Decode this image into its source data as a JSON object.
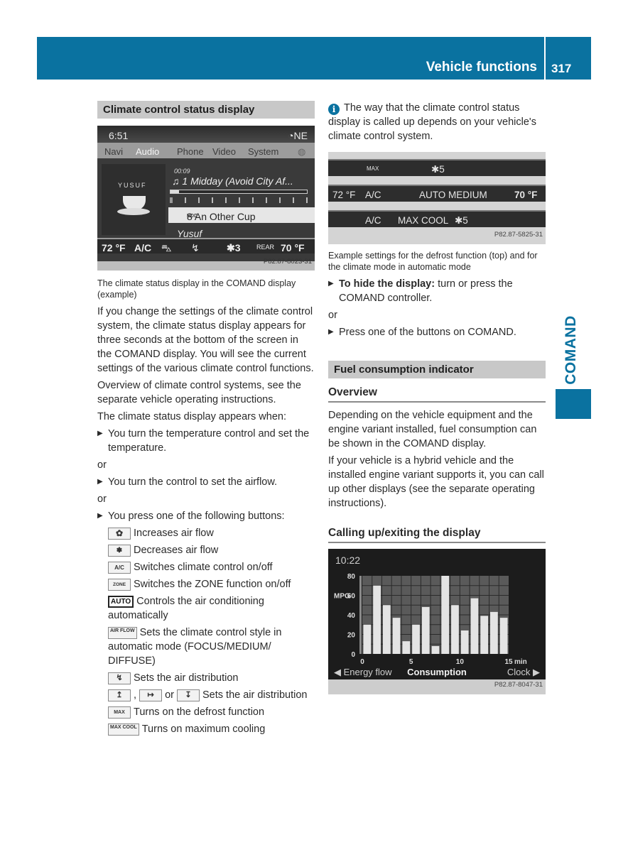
{
  "header": {
    "title": "Vehicle functions",
    "page_number": "317"
  },
  "side_tab": {
    "label": "COMAND"
  },
  "colors": {
    "brand_blue": "#0a72a0",
    "section_bar": "#c8c8c8"
  },
  "left": {
    "section_title": "Climate control status display",
    "screenshot1": {
      "time": "6:51",
      "compass": "◔NE",
      "nav_tabs": [
        "Navi",
        "Audio",
        "Phone",
        "Video",
        "System"
      ],
      "active_tab": "Audio",
      "elapsed": "00:09",
      "album_artist_logo": "YUSUF",
      "track": "♫  1 Midday (Avoid City Af...",
      "progress_fraction": 0.06,
      "selected_track": "8 An Other Cup",
      "source_badge": "HDD",
      "artist": "Yusuf",
      "climate": {
        "left_temp": "72 °F",
        "ac": "A/C",
        "fan": "✱3",
        "rear": "REAR",
        "right_temp": "70 °F"
      },
      "image_code": "P82.87-8023-31"
    },
    "caption": "The climate status display in the COMAND display (example)",
    "para1": "If you change the settings of the climate control system, the climate status display appears for three seconds at the bottom of the screen in the COMAND display. You will see the current settings of the various climate control functions.",
    "para2": "Overview of climate control systems, see the separate vehicle operating instructions.",
    "para3": "The climate status display appears when:",
    "bullet1": "You turn the temperature control and set the temperature.",
    "or": "or",
    "bullet2": "You turn the control to set the airflow.",
    "bullet3": "You press one of the following buttons:",
    "buttons": [
      {
        "icon": "fan-increase-icon",
        "glyph": "✿",
        "text": "Increases air flow"
      },
      {
        "icon": "fan-decrease-icon",
        "glyph": "✽",
        "text": "Decreases air flow"
      },
      {
        "icon": "ac-button-icon",
        "glyph": "A/C",
        "text": "Switches climate control on/off"
      },
      {
        "icon": "zone-button-icon",
        "glyph": "ZONE",
        "text": "Switches the ZONE function on/off"
      },
      {
        "icon": "auto-button-icon",
        "glyph": "AUTO",
        "text": "Controls the air conditioning automatically"
      },
      {
        "icon": "airflow-button-icon",
        "glyph": "AIR FLOW",
        "text": "Sets the climate control style in automatic mode (FOCUS/MEDIUM/ DIFFUSE)"
      },
      {
        "icon": "air-distribution-icon",
        "glyph": "↯",
        "text": "Sets the air distribution"
      },
      {
        "icon": "air-distribution-icons",
        "glyphs": [
          "↥",
          "↦",
          "↧"
        ],
        "sep1": ",",
        "sep2": "or",
        "text": "Sets the air distribution"
      },
      {
        "icon": "defrost-max-icon",
        "glyph": "MAX",
        "text": "Turns on the defrost function"
      },
      {
        "icon": "max-cool-icon",
        "glyph": "MAX COOL",
        "text": "Turns on maximum cooling"
      }
    ]
  },
  "right": {
    "info_note": "The way that the climate control status display is called up depends on your vehicle's climate control system.",
    "screenshot2": {
      "row1": {
        "defrost": "MAX",
        "fan": "✱5"
      },
      "row2": {
        "left_temp": "72 °F",
        "ac": "A/C",
        "mode": "AUTO  MEDIUM",
        "right_temp": "70 °F"
      },
      "row3": {
        "ac": "A/C",
        "mode": "MAX COOL",
        "fan": "✱5"
      },
      "image_code": "P82.87-5825-31"
    },
    "caption": "Example settings for the defrost function (top) and for the climate mode in automatic mode",
    "hide_bold": "To hide the display:",
    "hide_rest": " turn or press the COMAND controller.",
    "or": "or",
    "bullet_press": "Press one of the buttons on COMAND.",
    "section_title": "Fuel consumption indicator",
    "overview_title": "Overview",
    "overview_p1": "Depending on the vehicle equipment and the engine variant installed, fuel consumption can be shown in the COMAND display.",
    "overview_p2": "If your vehicle is a hybrid vehicle and the installed engine variant supports it, you can call up other displays (see the separate operating instructions).",
    "calling_title": "Calling up/exiting the display",
    "screenshot3": {
      "time": "10:22",
      "nav_left": "◀ Energy flow",
      "nav_center": "Consumption",
      "nav_right": "Clock ▶",
      "image_code": "P82.87-8047-31"
    }
  },
  "chart_data": {
    "type": "bar",
    "title": "Consumption",
    "xlabel": "min",
    "ylabel": "MPG",
    "x": [
      1,
      2,
      3,
      4,
      5,
      6,
      7,
      8,
      9,
      10,
      11,
      12,
      13,
      14,
      15
    ],
    "values": [
      30,
      70,
      50,
      37,
      13,
      30,
      48,
      8,
      80,
      50,
      24,
      57,
      39,
      43,
      37
    ],
    "ylim": [
      0,
      80
    ],
    "xlim": [
      0,
      15
    ],
    "yticks": [
      0,
      20,
      40,
      60,
      80
    ],
    "xticks": [
      0,
      5,
      10,
      15
    ],
    "grid": true,
    "bar_color": "#e4e4e4",
    "plot_bg": "#5a5a5a"
  }
}
